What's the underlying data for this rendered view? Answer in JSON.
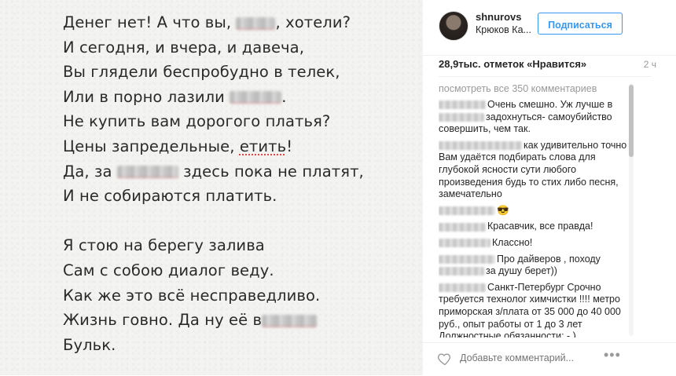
{
  "poem": {
    "lines": [
      {
        "before": "Денег нет! А что вы, ",
        "blur": true,
        "after": ", хотели?"
      },
      {
        "text": "И сегодня, и вчера, и давеча,"
      },
      {
        "text": "Вы глядели беспробудно в телек,"
      },
      {
        "before": "Или в порно лазили ",
        "blur": true,
        "after": "."
      },
      {
        "text": "Не купить вам дорогого платья?"
      },
      {
        "before": "Цены запредельные, ",
        "typo": "етить",
        "after": "!"
      },
      {
        "before": "Да, за ",
        "blur": true,
        "after": " здесь пока не платят,"
      },
      {
        "text": "И не собираются платить."
      },
      {
        "gap": true
      },
      {
        "text": "Я стою на берегу залива"
      },
      {
        "text": "Сам с собою диалог веду."
      },
      {
        "text": "Как же это всё несправедливо."
      },
      {
        "before": "Жизнь говно. Да ну её в",
        "blur": true,
        "after": ""
      },
      {
        "text": "Бульк."
      }
    ]
  },
  "post": {
    "username": "shnurovs",
    "location": "Крюков Ка...",
    "follow_label": "Подписаться",
    "likes": "28,9тыс. отметок «Нравится»",
    "time_ago": "2 ч",
    "view_all": "посмотреть все 350 комментариев",
    "comments": [
      {
        "text": "Очень смешно. Уж лучше в ",
        "tail": "задохнуться- самоубийство совершить, чем так.",
        "inline_blur": true
      },
      {
        "text": "как удивительно точно Вам удаётся подбирать слова для глубокой ясности сути любого произведения будь то стих либо песня, замечательно"
      },
      {
        "text": "😎"
      },
      {
        "text": "Красавчик, все правда!"
      },
      {
        "text": "Классно!"
      },
      {
        "text": "Про дайверов , походу ",
        "tail": "за душу берет))",
        "inline_blur": true
      },
      {
        "text": "Санкт-Петербург Срочно требуется технолог химчистки !!!! метро приморская з/плата от 35 000 до 40 000 руб., опыт работы от 1 до 3 лет Должностные обязанности: - )"
      }
    ],
    "add_comment_placeholder": "Добавьте комментарий...",
    "more_icon": "•••"
  }
}
